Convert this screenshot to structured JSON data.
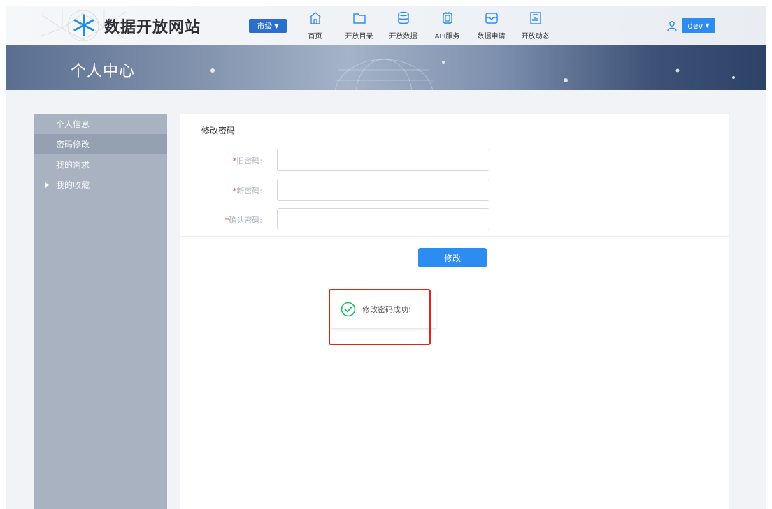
{
  "header": {
    "site_title": "数据开放网站",
    "city_select": "市级",
    "nav": [
      {
        "label": "首页",
        "icon": "home-icon"
      },
      {
        "label": "开放目录",
        "icon": "folder-icon"
      },
      {
        "label": "开放数据",
        "icon": "database-icon"
      },
      {
        "label": "API服务",
        "icon": "chip-icon"
      },
      {
        "label": "数据申请",
        "icon": "inbox-icon"
      },
      {
        "label": "开放动态",
        "icon": "report-icon"
      }
    ],
    "user": "dev"
  },
  "banner": {
    "title": "个人中心"
  },
  "sidebar": {
    "items": [
      {
        "label": "个人信息"
      },
      {
        "label": "密码修改"
      },
      {
        "label": "我的需求"
      },
      {
        "label": "我的收藏"
      }
    ],
    "active_index": 1
  },
  "form": {
    "title": "修改密码",
    "fields": [
      {
        "label": "旧密码:",
        "value": ""
      },
      {
        "label": "新密码:",
        "value": ""
      },
      {
        "label": "确认密码:",
        "value": ""
      }
    ],
    "required_mark": "*",
    "submit": "修改"
  },
  "toast": {
    "message": "修改密码成功!"
  },
  "colors": {
    "primary": "#2d8cf0",
    "sidebar": "#a8b2c0",
    "highlight": "#e1251b"
  }
}
